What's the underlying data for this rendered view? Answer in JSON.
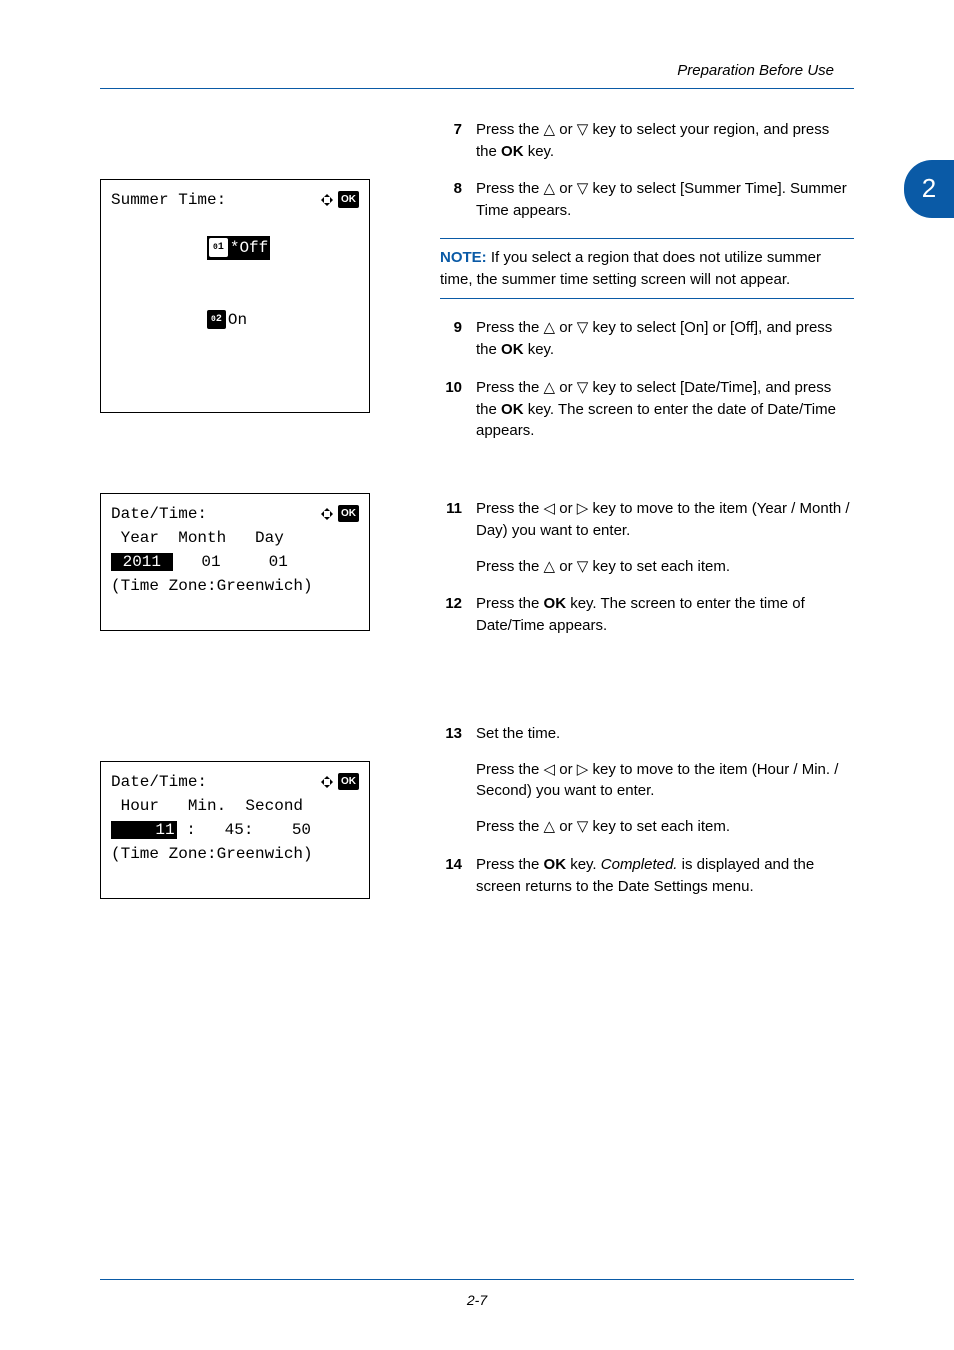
{
  "header": {
    "title": "Preparation Before Use"
  },
  "chapter_tab": "2",
  "footer": {
    "page": "2-7"
  },
  "lcd1": {
    "title": "Summer Time:",
    "ok": "OK",
    "opt1_num": "1",
    "opt1_text": "*Off",
    "opt2_num": "2",
    "opt2_text": "On"
  },
  "lcd2": {
    "title": "Date/Time:",
    "ok": "OK",
    "header_line": " Year  Month   Day",
    "year_val": " 2011 ",
    "rest_line": "   01     01",
    "tz_line": "(Time Zone:Greenwich)"
  },
  "lcd3": {
    "title": "Date/Time:",
    "ok": "OK",
    "header_line": " Hour   Min.  Second",
    "pre_spaces": "    ",
    "hour_val": "11",
    "rest_line": " :   45:    50",
    "tz_line": "(Time Zone:Greenwich)"
  },
  "steps": {
    "s7": {
      "num": "7",
      "t1": "Press the ",
      "t2": " or ",
      "t3": " key to select your region, and press the ",
      "ok": "OK",
      "t4": " key."
    },
    "s8": {
      "num": "8",
      "t1": "Press the ",
      "t2": " or ",
      "t3": " key to select [Summer Time]. Summer Time appears."
    },
    "note": {
      "label": "NOTE:",
      "text": " If you select a region that does not utilize summer time, the summer time setting screen will not appear."
    },
    "s9": {
      "num": "9",
      "t1": "Press the ",
      "t2": " or ",
      "t3": " key to select [On] or [Off], and press the ",
      "ok": "OK",
      "t4": " key."
    },
    "s10": {
      "num": "10",
      "t1": "Press the ",
      "t2": " or ",
      "t3": " key to select [Date/Time], and press the ",
      "ok": "OK",
      "t4": " key. The screen to enter the date of Date/Time appears."
    },
    "s11": {
      "num": "11",
      "t1": "Press the ",
      "t2": " or ",
      "t3": " key to move to the item (Year / Month / Day) you want to enter.",
      "p2a": "Press the ",
      "p2b": " or ",
      "p2c": " key to set each item."
    },
    "s12": {
      "num": "12",
      "t1": "Press the ",
      "ok": "OK",
      "t2": " key. The screen to enter the time of Date/Time appears."
    },
    "s13": {
      "num": "13",
      "t1": "Set the time.",
      "p2a": "Press the ",
      "p2b": " or ",
      "p2c": " key to move to the item (Hour / Min. / Second) you want to enter.",
      "p3a": "Press the ",
      "p3b": " or ",
      "p3c": " key to set each item."
    },
    "s14": {
      "num": "14",
      "t1": "Press the ",
      "ok": "OK",
      "t2": " key. ",
      "em": "Completed.",
      "t3": " is displayed and the screen returns to the Date Settings menu."
    }
  }
}
